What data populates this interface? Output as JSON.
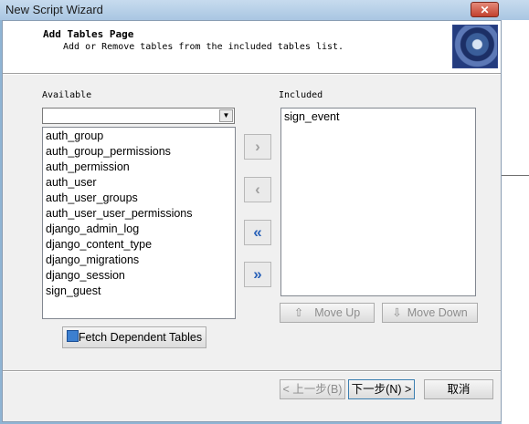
{
  "window": {
    "title": "New Script Wizard",
    "close_label": "✕"
  },
  "header": {
    "title": "Add Tables Page",
    "subtitle": "Add or Remove tables from the included tables list."
  },
  "available": {
    "label": "Available",
    "combo_value": "",
    "items": [
      "auth_group",
      "auth_group_permissions",
      "auth_permission",
      "auth_user",
      "auth_user_groups",
      "auth_user_user_permissions",
      "django_admin_log",
      "django_content_type",
      "django_migrations",
      "django_session",
      "sign_guest"
    ],
    "fetch_label": "Fetch Dependent Tables"
  },
  "included": {
    "label": "Included",
    "items": [
      "sign_event"
    ],
    "move_up_label": "Move Up",
    "move_down_label": "Move Down"
  },
  "transfer": {
    "add_icon": "›",
    "remove_icon": "‹",
    "add_all_icon": "«",
    "remove_all_icon": "»"
  },
  "footer": {
    "back_label": "< 上一步(B)",
    "next_label": "下一步(N) >",
    "cancel_label": "取消"
  },
  "colors": {
    "arrow_active": "#2a62b8",
    "arrow_disabled": "#a0a0a0"
  }
}
